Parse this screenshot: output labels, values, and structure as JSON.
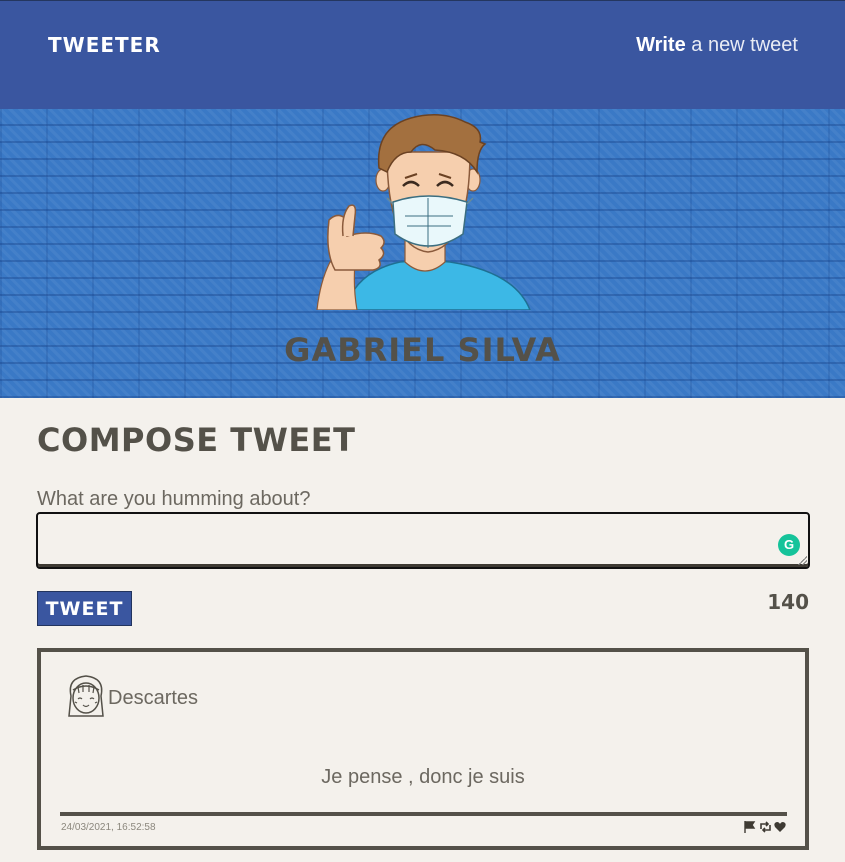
{
  "nav": {
    "brand": "Tweeter",
    "write_strong": "Write",
    "write_rest": " a new tweet"
  },
  "profile": {
    "name": "Gabriel Silva",
    "avatar_icon": "masked-boy-thumbs-up-icon"
  },
  "compose": {
    "title": "Compose Tweet",
    "prompt": "What are you humming about?",
    "input_value": "",
    "button_label": "Tweet",
    "counter": "140",
    "assistant_icon": "grammarly-icon"
  },
  "tweet": {
    "author": "Descartes",
    "avatar_icon": "girl-face-icon",
    "text": "Je pense , donc je suis",
    "date": "24/03/2021, 16:52:58",
    "actions": [
      "flag-icon",
      "retweet-icon",
      "heart-icon"
    ]
  },
  "colors": {
    "nav_bg": "#3a56a0",
    "banner_bg": "#3a79c6",
    "page_bg": "#f4f1ec",
    "text_dark": "#545149",
    "accent_green": "#15c39a"
  }
}
